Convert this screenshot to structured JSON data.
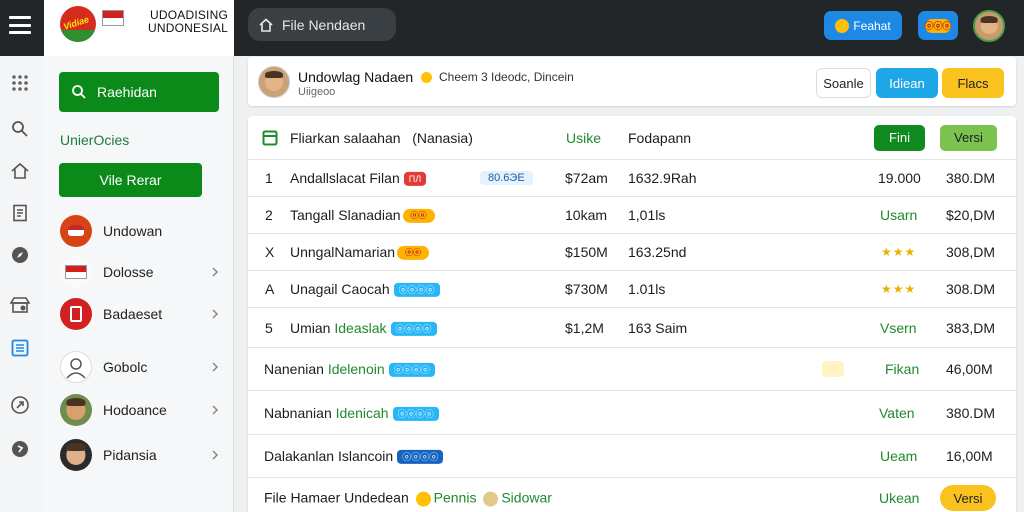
{
  "topbar": {
    "brand_logo_text": "Vidiae",
    "brand_title": "UDOADISING UNDONESIAL",
    "breadcrumb": "File Nendaen",
    "featured_label": "Feahat",
    "badge_label": "ⓞⓞⓞ"
  },
  "sidebar": {
    "search_label": "Raehidan",
    "heading": "UnierOcies",
    "view_button": "Vile Rerar",
    "items": [
      {
        "label": "Undowan",
        "chevron": false
      },
      {
        "label": "Dolosse",
        "chevron": true
      },
      {
        "label": "Badaeset",
        "chevron": true
      },
      {
        "label": "Gobolc",
        "chevron": true
      },
      {
        "label": "Hodoance",
        "chevron": true
      },
      {
        "label": "Pidansia",
        "chevron": true
      }
    ]
  },
  "header": {
    "title": "Undowlag Nadaen",
    "subtitle": "Cheem 3 Ideodc, Dincein",
    "meta": "Uiigeoo",
    "buttons": {
      "search": "Soanle",
      "primary": "Idiean",
      "secondary": "Flacs"
    }
  },
  "table": {
    "columns": {
      "name": "Fliarkan salaahan",
      "name_note": "(Nanasia)",
      "type": "Usike",
      "details": "Fodapann"
    },
    "header_buttons": {
      "first": "Fini",
      "second": "Versi"
    },
    "rows": [
      {
        "index": "1",
        "name": "Andallslacat Filan",
        "tag": "ПЛ",
        "subtag": "80.6ЭЕ",
        "price": "$72am",
        "details": "1632.9Rah",
        "value": "19.000",
        "amount": "380.DM"
      },
      {
        "index": "2",
        "name": "Tangall Slanadian",
        "emoji": "ⓞⓞ",
        "price": "10kam",
        "details": "1,01ls",
        "status": "Usarn",
        "amount": "$20,DM"
      },
      {
        "index": "X",
        "name": "UnngalNamarian",
        "emoji": "ⓞⓞ",
        "price": "$150M",
        "details": "163.25nd",
        "rating": "★★★",
        "amount": "308,DM"
      },
      {
        "index": "A",
        "name": "Unagail Caocah",
        "tag": "ⓞⓞⓞⓞ",
        "price": "$730M",
        "details": "1.01ls",
        "rating": "★★★",
        "amount": "308.DM"
      },
      {
        "index": "5",
        "name": "Umian",
        "name_green": "Ideaslak",
        "tag": "ⓞⓞⓞⓞ",
        "price": "$1,2M",
        "details": "163 Saim",
        "status": "Vsern",
        "amount": "383,DM"
      }
    ],
    "group_rows": [
      {
        "name": "Nanenian",
        "name_green": "Idelenoin",
        "tag": "ⓞⓞⓞⓞ",
        "status": "Fikan",
        "amount": "46,00M"
      },
      {
        "name": "Nabnanian",
        "name_green": "Idenicah",
        "tag": "ⓞⓞⓞⓞ",
        "status": "Vaten",
        "amount": "380.DM"
      },
      {
        "name": "Dalakanlan Islancoin",
        "tag": "ⓞⓞⓞⓞ",
        "status": "Ueam",
        "amount": "16,00M"
      }
    ],
    "footer_row": {
      "text": "File Hamaer Undedean",
      "extra1": "Pennis",
      "extra2": "Sidowar",
      "status": "Ukean",
      "button": "Versi"
    }
  },
  "colors": {
    "accent_green": "#0b8a1a",
    "accent_blue": "#1e88e5",
    "accent_yellow": "#f9c21f",
    "topbar": "#222628"
  }
}
